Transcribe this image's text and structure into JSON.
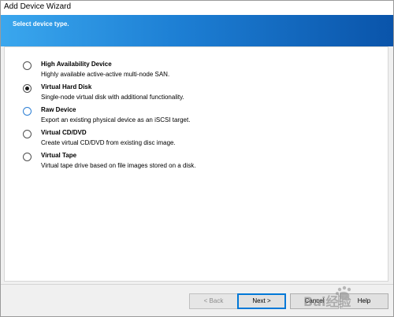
{
  "window": {
    "title": "Add Device Wizard"
  },
  "header": {
    "instruction": "Select device type."
  },
  "options": [
    {
      "title": "High Availability Device",
      "description": "Highly available active-active multi-node SAN.",
      "selected": false
    },
    {
      "title": "Virtual Hard Disk",
      "description": "Single-node virtual disk with additional functionality.",
      "selected": true
    },
    {
      "title": "Raw Device",
      "description": "Export an existing physical device as an iSCSI target.",
      "selected": false
    },
    {
      "title": "Virtual CD/DVD",
      "description": "Create virtual CD/DVD from existing disc image.",
      "selected": false
    },
    {
      "title": "Virtual Tape",
      "description": "Virtual tape drive based on file images stored on a disk.",
      "selected": false
    }
  ],
  "buttons": {
    "back": "< Back",
    "next": "Next >",
    "cancel": "Cancel",
    "help": "Help"
  },
  "watermark": {
    "text": "Bai经验"
  },
  "colors": {
    "banner_start": "#3aa7ee",
    "banner_end": "#0a54aa",
    "focus": "#0078d7"
  }
}
